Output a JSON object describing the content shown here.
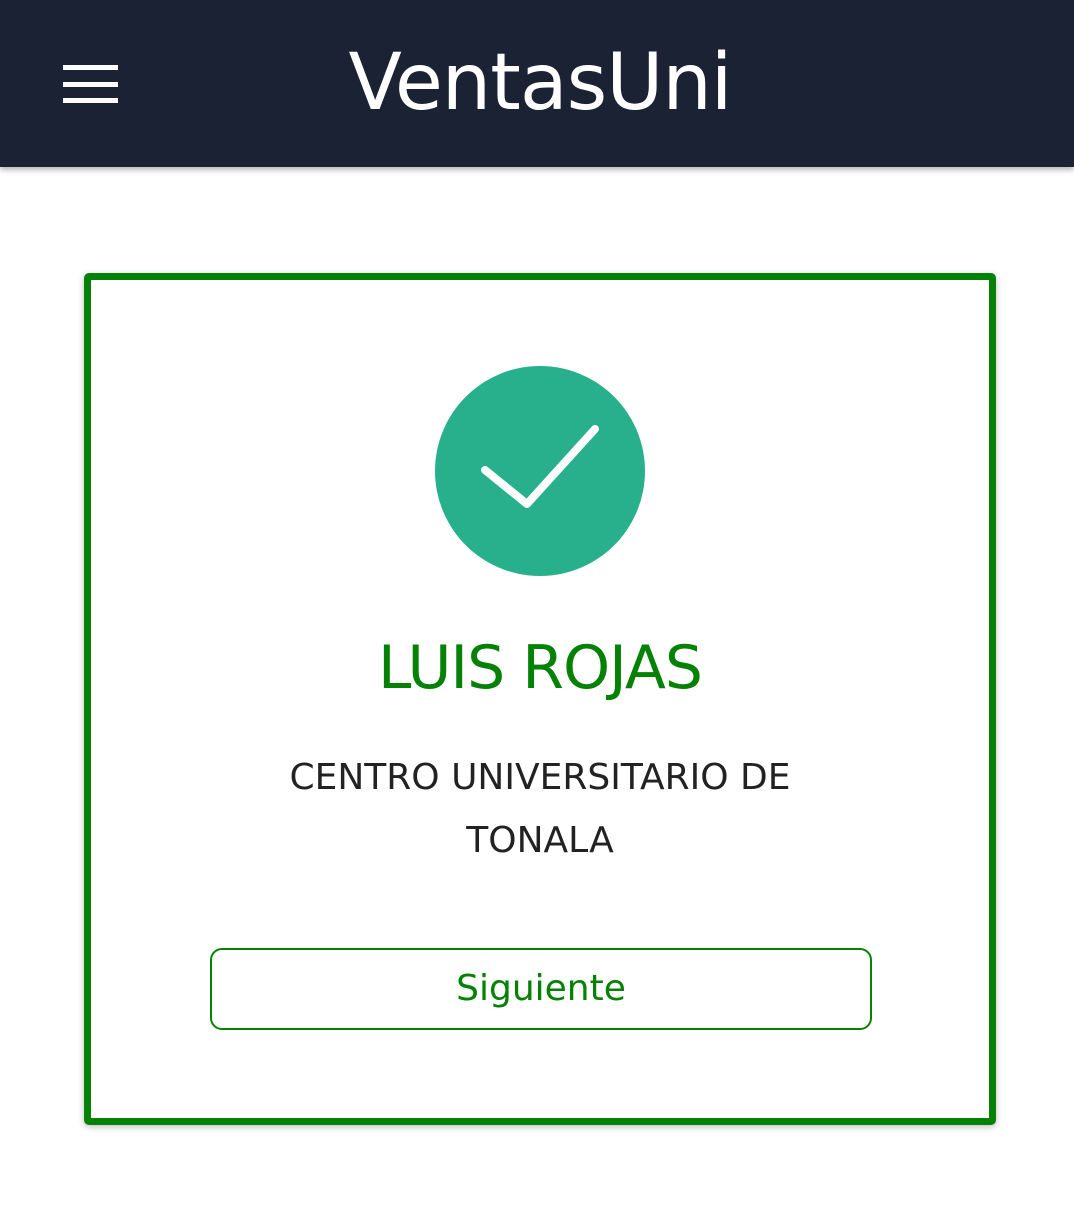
{
  "header": {
    "title": "VentasUni",
    "menu_icon": "hamburger-menu-icon",
    "background_color": "#1a2233"
  },
  "result_card": {
    "status_icon": "checkmark-circle-icon",
    "status_color": "#28af8b",
    "name": "LUIS ROJAS",
    "campus": "CENTRO UNIVERSITARIO DE TONALA",
    "next_label": "Siguiente",
    "accent_color": "#058205"
  }
}
